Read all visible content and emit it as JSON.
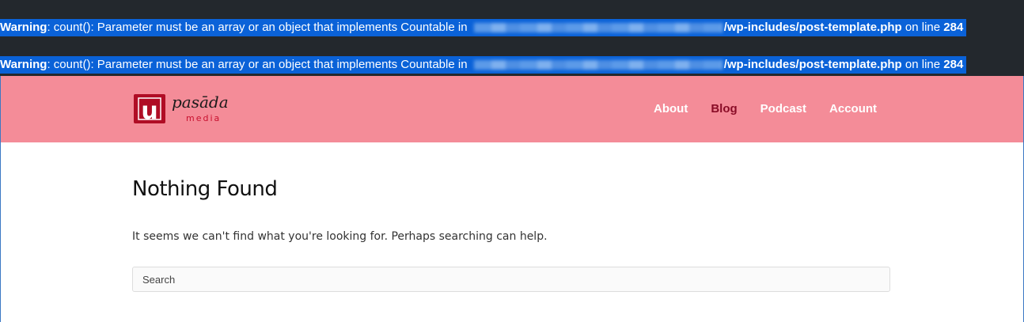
{
  "warnings": [
    {
      "label": "Warning",
      "message": ": count(): Parameter must be an array or an object that implements Countable in ",
      "file": "/wp-includes/post-template.php",
      "line_text": " on line ",
      "line_number": "284"
    },
    {
      "label": "Warning",
      "message": ": count(): Parameter must be an array or an object that implements Countable in ",
      "file": "/wp-includes/post-template.php",
      "line_text": " on line ",
      "line_number": "284"
    }
  ],
  "header": {
    "logo": {
      "wordmark": "pasāda",
      "subtext": "media",
      "mark_letter": "u"
    },
    "nav": [
      {
        "label": "About",
        "active": false
      },
      {
        "label": "Blog",
        "active": true
      },
      {
        "label": "Podcast",
        "active": false
      },
      {
        "label": "Account",
        "active": false
      }
    ]
  },
  "main": {
    "title": "Nothing Found",
    "message": "It seems we can't find what you're looking for. Perhaps searching can help.",
    "search": {
      "placeholder": "Search",
      "value": ""
    }
  },
  "colors": {
    "warning_bar_bg": "#23282d",
    "warning_highlight": "#0a62d8",
    "navbar_bg": "#f48c98",
    "nav_active": "#8a0d27",
    "logo_red": "#c8102e"
  }
}
